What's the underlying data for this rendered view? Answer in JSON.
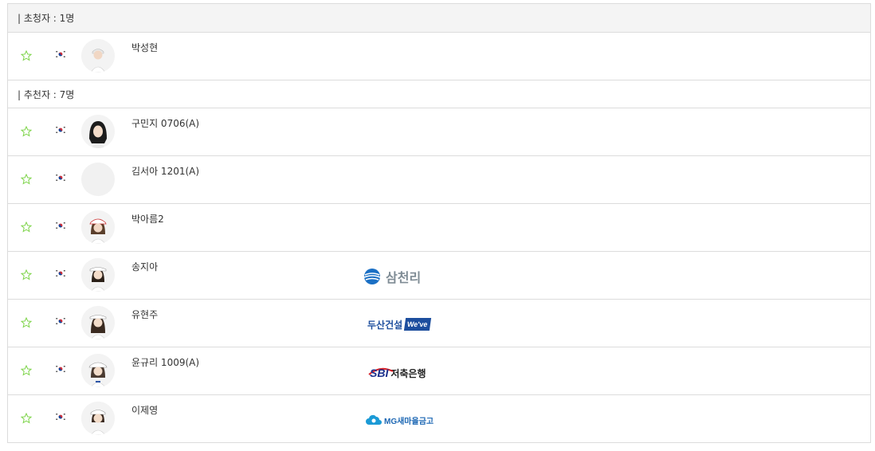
{
  "sections": [
    {
      "header": "| 초청자 : 1명",
      "players": [
        {
          "name": "박성현",
          "avatar": "player",
          "sponsor": null
        }
      ]
    },
    {
      "header": "| 추천자 : 7명",
      "players": [
        {
          "name": "구민지 0706(A)",
          "avatar": "player-dark-hair",
          "sponsor": null
        },
        {
          "name": "김서아 1201(A)",
          "avatar": "placeholder",
          "sponsor": null
        },
        {
          "name": "박아름2",
          "avatar": "player-cap",
          "sponsor": null
        },
        {
          "name": "송지아",
          "avatar": "player-visor",
          "sponsor": "삼천리"
        },
        {
          "name": "유현주",
          "avatar": "player-visor",
          "sponsor": "두산건설 We've"
        },
        {
          "name": "윤규리 1009(A)",
          "avatar": "player-cap",
          "sponsor": "SBI 저축은행"
        },
        {
          "name": "이제영",
          "avatar": "player-cap",
          "sponsor": "MG새마을금고"
        }
      ]
    }
  ],
  "sponsors": {
    "samchully": {
      "label": "삼천리",
      "color": "#7f8c95",
      "accent": "#1a6fc4"
    },
    "doosan": {
      "label": "두산건설",
      "badge": "We've",
      "color": "#1d4e9e"
    },
    "sbi": {
      "mark": "SBI",
      "label": "저축은행",
      "color": "#1b2f8c",
      "accent": "#d8232a"
    },
    "mg": {
      "label": "MG새마을금고",
      "color": "#1b66b3"
    }
  },
  "colors": {
    "star": "#7ed44a",
    "border": "#dcdcdc",
    "header_bg": "#f4f4f4"
  }
}
